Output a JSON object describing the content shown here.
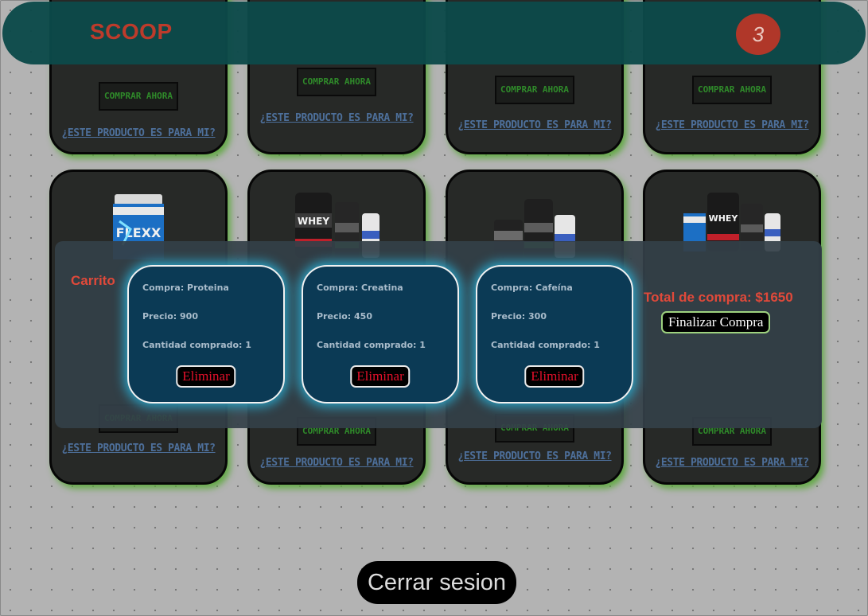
{
  "header": {
    "brand": "SCOOP",
    "cart_count": "3"
  },
  "products": {
    "buy_label": "COMPRAR AHORA",
    "info_link": "¿ESTE PRODUCTO ES PARA MI?"
  },
  "cart": {
    "title": "Carrito",
    "items": [
      {
        "name": "Compra: Proteina",
        "price": "Precio: 900",
        "qty": "Cantidad comprado: 1",
        "delete_label": "Eliminar"
      },
      {
        "name": "Compra: Creatina",
        "price": "Precio: 450",
        "qty": "Cantidad comprado: 1",
        "delete_label": "Eliminar"
      },
      {
        "name": "Compra: Cafeína",
        "price": "Precio: 300",
        "qty": "Cantidad comprado: 1",
        "delete_label": "Eliminar"
      }
    ],
    "total": "Total de compra: $1650",
    "finalize_label": "Finalizar Compra"
  },
  "logout_label": "Cerrar sesion",
  "colors": {
    "header_bg": "#0c4a4a",
    "brand": "#c43c2c",
    "accent_red": "#e0493a",
    "card_glow": "#5ca83c",
    "cart_item_bg": "#0b3a55",
    "delete_text": "#e3102a"
  },
  "icons": {
    "product_images": [
      "flexx-tub",
      "whey-creatine-caffeine-stack",
      "bcaa-creatine-caffeine-stack",
      "flexx-whey-creatine-caffeine-stack"
    ]
  }
}
